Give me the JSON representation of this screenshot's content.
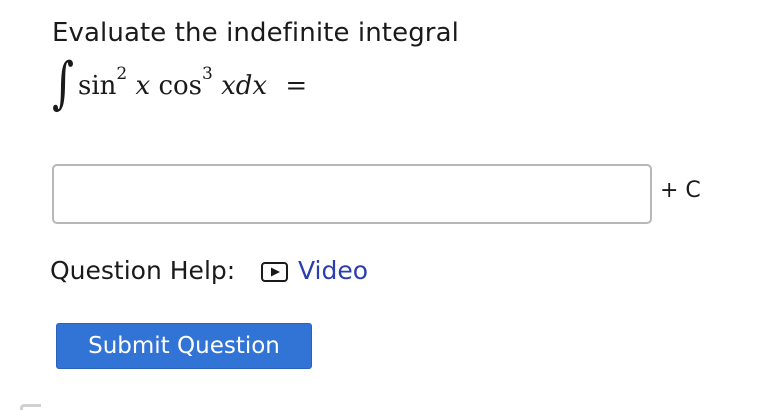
{
  "question": {
    "prompt": "Evaluate the indefinite integral",
    "math": {
      "integral_symbol": "∫",
      "fn1": "sin",
      "exp1": "2",
      "var1": "x",
      "fn2": "cos",
      "exp2": "3",
      "var2": "xdx",
      "equals": "="
    },
    "answer": {
      "value": "",
      "placeholder": ""
    },
    "constant": "+ C"
  },
  "help": {
    "label": "Question Help:",
    "video_label": "Video",
    "video_icon": "play-icon"
  },
  "submit": {
    "label": "Submit Question",
    "color": "#3273d6"
  },
  "colors": {
    "link": "#2b3fb3",
    "input_border": "#b7b7b7"
  }
}
